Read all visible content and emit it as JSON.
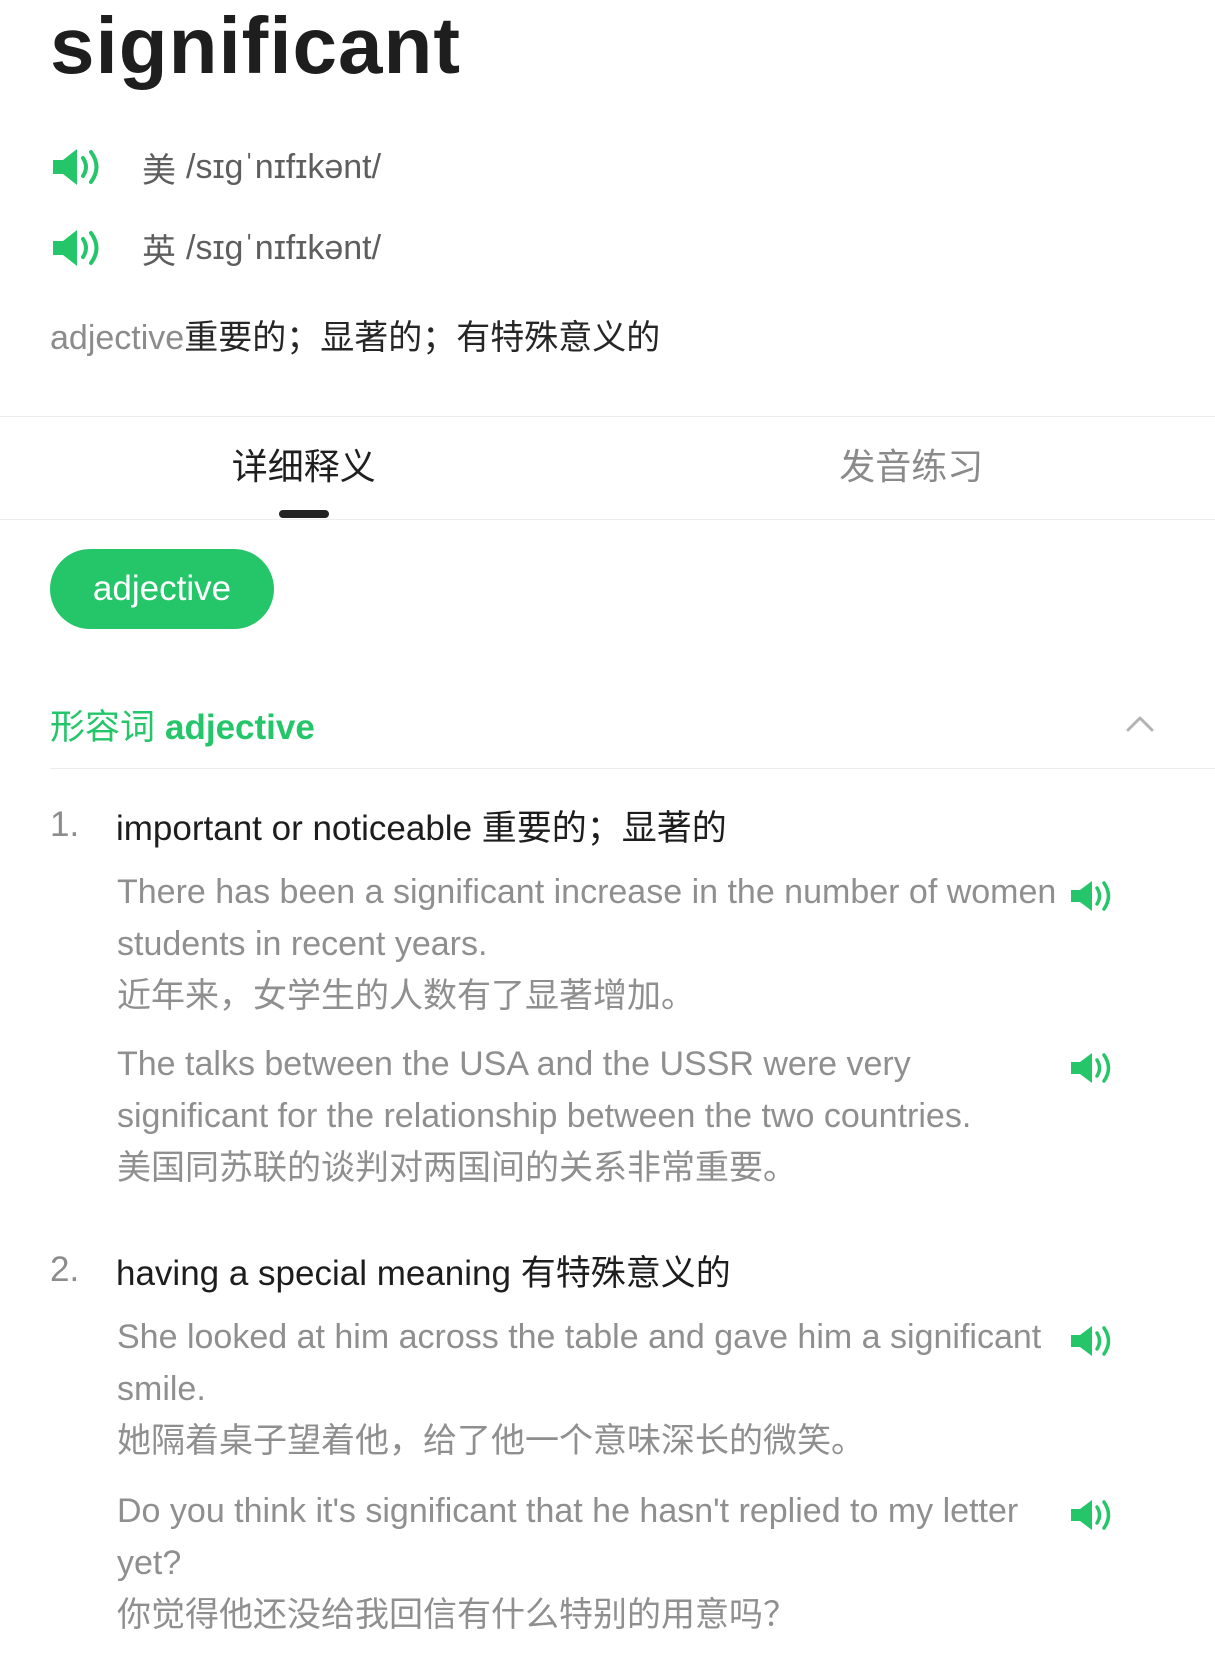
{
  "word": "significant",
  "pronunciations": [
    {
      "region": "美",
      "ipa": "/sɪɡˈnɪfɪkənt/"
    },
    {
      "region": "英",
      "ipa": "/sɪɡˈnɪfɪkənt/"
    }
  ],
  "summary": {
    "pos": "adjective",
    "meaning": "重要的；显著的；有特殊意义的"
  },
  "tabs": [
    {
      "label": "详细释义",
      "active": true
    },
    {
      "label": "发音练习",
      "active": false
    }
  ],
  "pos_pill": "adjective",
  "section": {
    "zh": "形容词",
    "en": "adjective"
  },
  "senses": [
    {
      "num": "1.",
      "definition": "important or noticeable 重要的；显著的",
      "examples": [
        {
          "en": "There has been a significant increase in the number of women students in recent years.",
          "zh": "近年来，女学生的人数有了显著增加。"
        },
        {
          "en": "The talks between the USA and the USSR were very significant for the relationship between the two countries.",
          "zh": "美国同苏联的谈判对两国间的关系非常重要。"
        }
      ]
    },
    {
      "num": "2.",
      "definition": "having a special meaning 有特殊意义的",
      "examples": [
        {
          "en": "She looked at him across the table and gave him a significant smile.",
          "zh": "她隔着桌子望着他，给了他一个意味深长的微笑。"
        },
        {
          "en": "Do you think it's significant that he hasn't replied to my letter yet?",
          "zh": "你觉得他还没给我回信有什么特别的用意吗？"
        }
      ]
    }
  ],
  "icons": {
    "speaker": "speaker-icon",
    "collapse": "chevron-up-icon"
  },
  "colors": {
    "accent": "#25c66a",
    "text": "#1d1d1d",
    "muted": "#8f8f8f"
  }
}
